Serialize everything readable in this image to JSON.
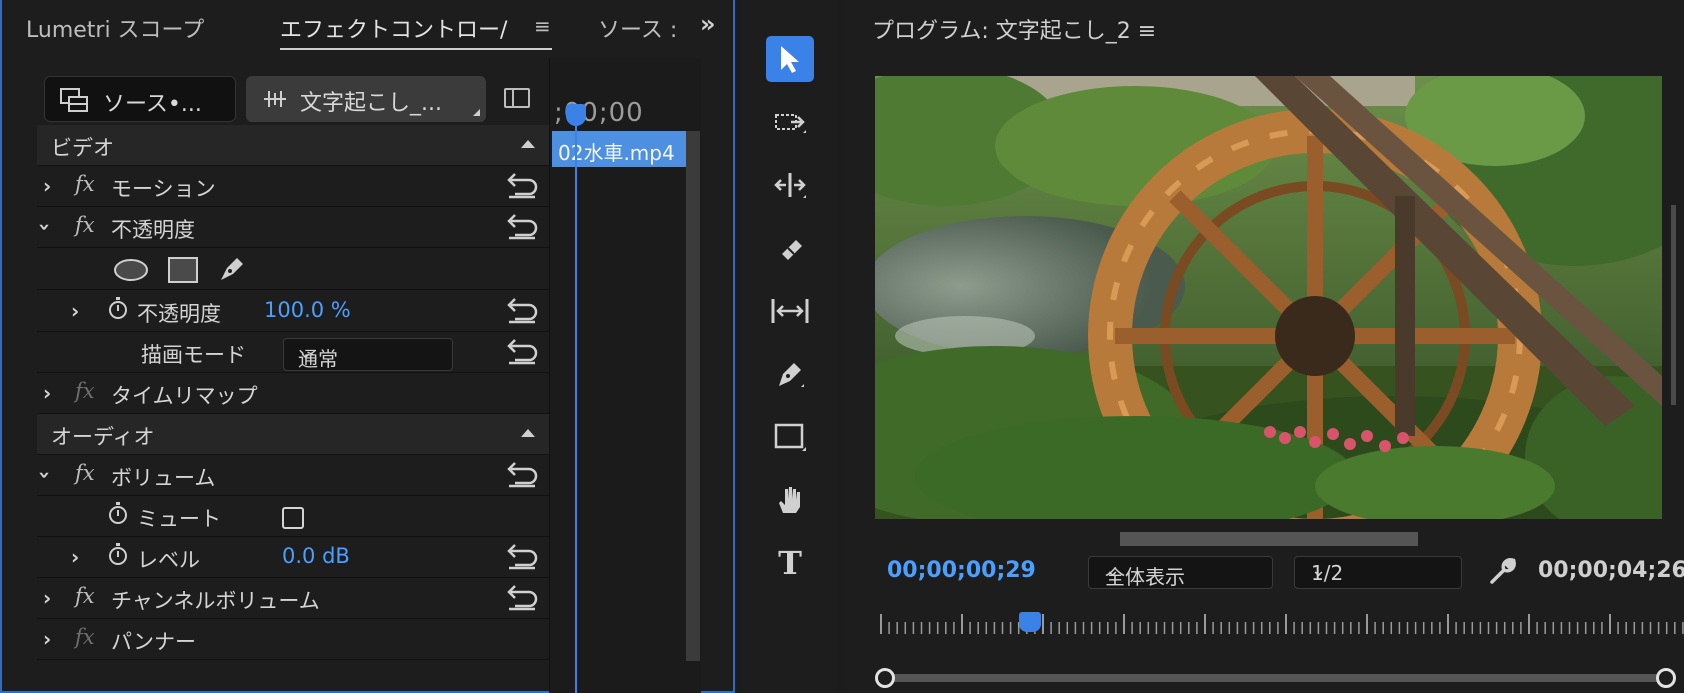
{
  "left_panel": {
    "tabs": {
      "lumetri": "Lumetri スコープ",
      "effect_controls": "エフェクトコントロー/",
      "source": "ソース :"
    },
    "source_chip": "ソース•...",
    "sequence_chip": "文字起こし_...",
    "timeline": {
      "timecode": ";00;00",
      "clip_name": "02水車.mp4"
    },
    "video_section": "ビデオ",
    "rows": {
      "motion": "モーション",
      "opacity": "不透明度",
      "opacity_param": "不透明度",
      "opacity_value": "100.0 %",
      "blend_mode_label": "描画モード",
      "blend_mode_value": "通常",
      "time_remap": "タイムリマップ"
    },
    "audio_section": "オーディオ",
    "audio_rows": {
      "volume": "ボリューム",
      "mute": "ミュート",
      "level": "レベル",
      "level_value": "0.0 dB",
      "channel_volume": "チャンネルボリューム",
      "panner": "パンナー"
    },
    "fx_label": "fx"
  },
  "tools": [
    "selection-tool",
    "track-select-tool",
    "ripple-edit-tool",
    "razor-tool",
    "slip-tool",
    "pen-tool",
    "rectangle-tool",
    "hand-tool",
    "type-tool"
  ],
  "tool_text": {
    "type_tool_glyph": "T"
  },
  "monitor": {
    "title": "プログラム: 文字起こし_2",
    "menu_glyph": "≡",
    "timecode_current": "00;00;00;29",
    "zoom_select": "全体表示",
    "resolution_select": "1/2",
    "timecode_duration": "00;00;04;26"
  },
  "colors": {
    "accent": "#3a82e8",
    "timecode_blue": "#4a9fff",
    "panel_bg": "#1d1d1d"
  }
}
